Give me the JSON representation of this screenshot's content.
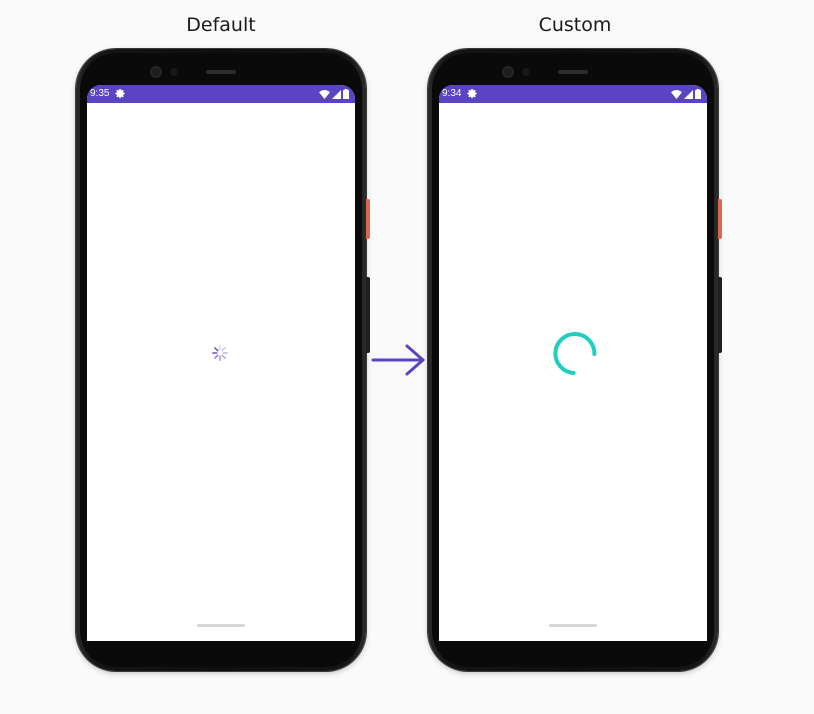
{
  "labels": {
    "default": "Default",
    "custom": "Custom"
  },
  "phones": {
    "default": {
      "status_time": "9:35",
      "spinner": "ios-activity-indicator-icon",
      "spinner_color": "#5a44c1"
    },
    "custom": {
      "status_time": "9:34",
      "spinner": "circular-progress-ring-icon",
      "spinner_color": "#1ecfc0"
    }
  },
  "colors": {
    "statusbar": "#5a44c1",
    "arrow": "#5a44c1",
    "screen": "#ffffff",
    "background": "#fafafa"
  },
  "icons": [
    "gear-icon",
    "wifi-icon",
    "cell-signal-icon",
    "battery-icon",
    "arrow-right-icon"
  ]
}
